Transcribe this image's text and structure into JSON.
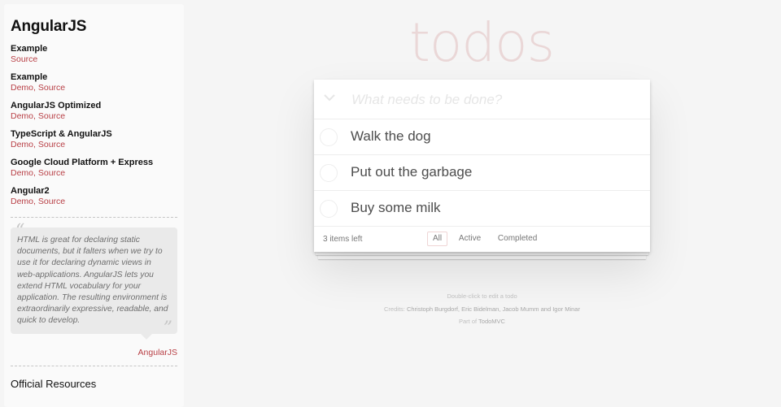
{
  "sidebar": {
    "title": "AngularJS",
    "examples": [
      {
        "name": "Example",
        "links": [
          "Source"
        ]
      },
      {
        "name": "Example",
        "links": [
          "Demo",
          "Source"
        ]
      },
      {
        "name": "AngularJS Optimized",
        "links": [
          "Demo",
          "Source"
        ]
      },
      {
        "name": "TypeScript & AngularJS",
        "links": [
          "Demo",
          "Source"
        ]
      },
      {
        "name": "Google Cloud Platform + Express",
        "links": [
          "Demo",
          "Source"
        ]
      },
      {
        "name": "Angular2",
        "links": [
          "Demo",
          "Source"
        ]
      }
    ],
    "quote": "HTML is great for declaring static documents, but it falters when we try to use it for declaring dynamic views in web-applications. AngularJS lets you extend HTML vocabulary for your application. The resulting environment is extraordinarily expressive, readable, and quick to develop.",
    "quote_attribution": "AngularJS",
    "resources_heading": "Official Resources"
  },
  "app": {
    "title": "todos",
    "new_todo_placeholder": "What needs to be done?",
    "toggle_all_icon": "chevron-down-icon",
    "todos": [
      {
        "title": "Walk the dog",
        "completed": false
      },
      {
        "title": "Put out the garbage",
        "completed": false
      },
      {
        "title": "Buy some milk",
        "completed": false
      }
    ],
    "footer": {
      "count_text": "3 items left",
      "filters": [
        "All",
        "Active",
        "Completed"
      ],
      "selected_filter": "All"
    }
  },
  "info": {
    "line1": "Double-click to edit a todo",
    "credits_prefix": "Credits: ",
    "credits_names": "Christoph Burgdorf, Eric Bidelman, Jacob Mumm and Igor Minar",
    "part_of_prefix": "Part of ",
    "part_of_link": "TodoMVC"
  },
  "colors": {
    "background": "#f5f5f5",
    "accent_link": "#b83f45",
    "title_color": "rgba(175,47,47,0.15)"
  }
}
